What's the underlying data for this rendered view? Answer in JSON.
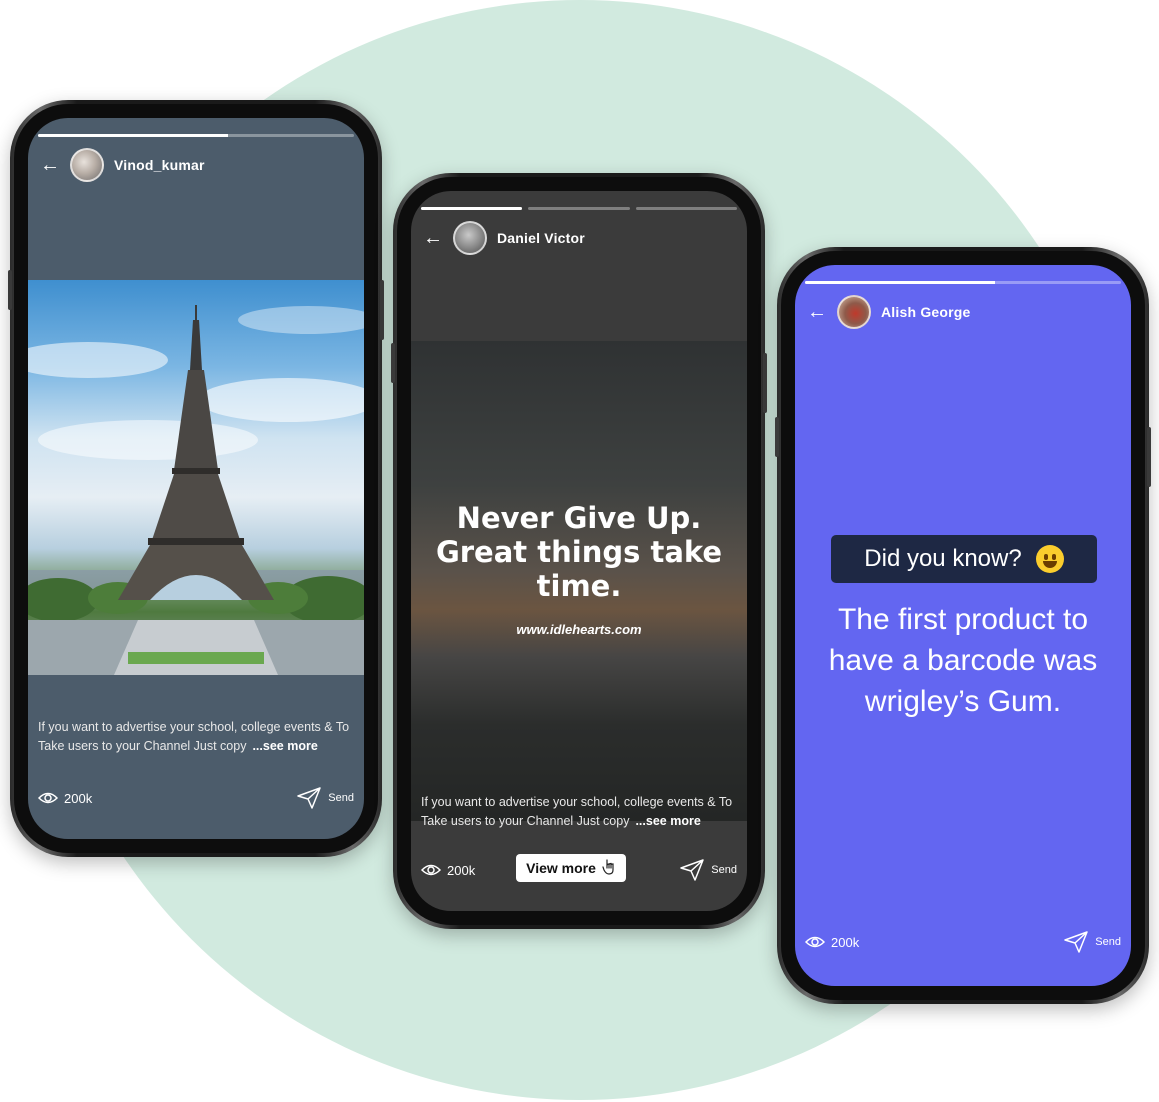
{
  "stories": [
    {
      "username": "Vinod_kumar",
      "caption": "If you want to advertise your school, college events & To Take users to your Channel Just copy",
      "see_more": "...see more",
      "views": "200k",
      "send": "Send",
      "progress": [
        0.6
      ]
    },
    {
      "username": "Daniel Victor",
      "quote": "Never Give Up. Great things take time.",
      "watermark": "www.idlehearts.com",
      "caption": "If you want to advertise your school, college events & To Take users to your Channel Just copy",
      "see_more": "...see more",
      "views": "200k",
      "view_more": "View more",
      "send": "Send",
      "progress": [
        1.0,
        0.0,
        0.0
      ]
    },
    {
      "username": "Alish George",
      "badge": "Did you know?",
      "fact": "The first product to have a barcode was wrigley’s Gum.",
      "views": "200k",
      "send": "Send",
      "progress": [
        0.6
      ]
    }
  ],
  "colors": {
    "background_circle": "#d1eadf",
    "story3_background": "#6366f1",
    "badge_background": "#1e2844"
  },
  "icons": [
    "back-arrow-icon",
    "eye-icon",
    "send-icon",
    "hand-pointer-icon",
    "grinning-emoji-icon"
  ]
}
